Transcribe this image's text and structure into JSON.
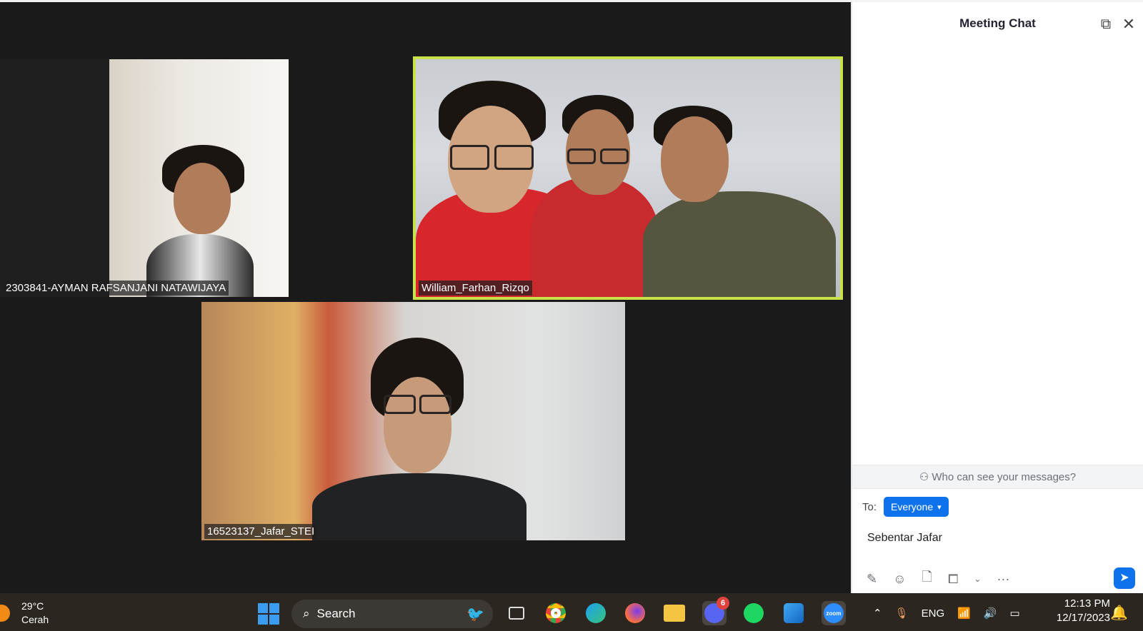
{
  "meeting": {
    "participants": [
      {
        "name": "2303841-AYMAN RAFSANJANI NATAWIJAYA"
      },
      {
        "name": "William_Farhan_Rizqo",
        "active_speaker": true
      },
      {
        "name": "16523137_Jafar_STEI"
      }
    ]
  },
  "chat": {
    "title": "Meeting Chat",
    "who_can_see": "Who can see your messages?",
    "to_label": "To:",
    "to_value": "Everyone",
    "draft_message": "Sebentar Jafar",
    "icons": [
      "popout-icon",
      "close-icon",
      "format-icon",
      "emoji-icon",
      "file-icon",
      "screenshot-icon",
      "chevron-down-icon",
      "more-icon",
      "send-icon"
    ]
  },
  "taskbar": {
    "weather_temp": "29°C",
    "weather_condition": "Cerah",
    "search_label": "Search",
    "apps": [
      "task-view",
      "chrome",
      "edge",
      "firefox",
      "file-explorer",
      "discord",
      "spotify",
      "photos",
      "zoom"
    ],
    "discord_badge": "6",
    "zoom_label": "zoom",
    "language": "ENG",
    "time": "12:13 PM",
    "date": "12/17/2023"
  },
  "colors": {
    "active_speaker_border": "#c9e24a",
    "accent_blue": "#0e72ed",
    "stage_bg": "#1a1a1a",
    "taskbar_bg": "#2b2620"
  }
}
